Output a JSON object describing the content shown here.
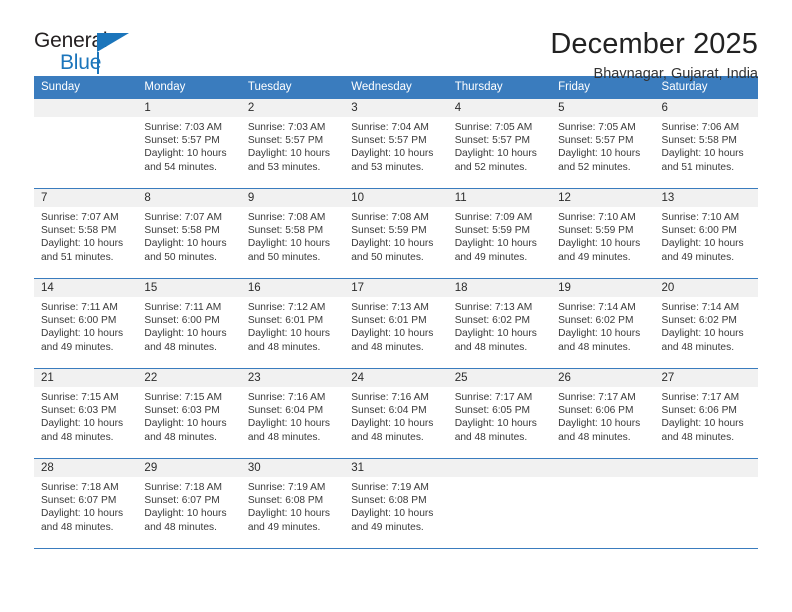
{
  "logo": {
    "line1": "General",
    "line2": "Blue",
    "brand_color": "#1b75bb",
    "triangle_icon": "triangle-icon"
  },
  "header": {
    "title": "December 2025",
    "subtitle": "Bhavnagar, Gujarat, India"
  },
  "calendar": {
    "accent_color": "#3a7cbe",
    "daynum_bg": "#f1f1f1",
    "weekdays": [
      "Sunday",
      "Monday",
      "Tuesday",
      "Wednesday",
      "Thursday",
      "Friday",
      "Saturday"
    ],
    "weeks": [
      [
        {
          "day": "",
          "sunrise": "",
          "sunset": "",
          "daylight1": "",
          "daylight2": ""
        },
        {
          "day": "1",
          "sunrise": "Sunrise: 7:03 AM",
          "sunset": "Sunset: 5:57 PM",
          "daylight1": "Daylight: 10 hours",
          "daylight2": "and 54 minutes."
        },
        {
          "day": "2",
          "sunrise": "Sunrise: 7:03 AM",
          "sunset": "Sunset: 5:57 PM",
          "daylight1": "Daylight: 10 hours",
          "daylight2": "and 53 minutes."
        },
        {
          "day": "3",
          "sunrise": "Sunrise: 7:04 AM",
          "sunset": "Sunset: 5:57 PM",
          "daylight1": "Daylight: 10 hours",
          "daylight2": "and 53 minutes."
        },
        {
          "day": "4",
          "sunrise": "Sunrise: 7:05 AM",
          "sunset": "Sunset: 5:57 PM",
          "daylight1": "Daylight: 10 hours",
          "daylight2": "and 52 minutes."
        },
        {
          "day": "5",
          "sunrise": "Sunrise: 7:05 AM",
          "sunset": "Sunset: 5:57 PM",
          "daylight1": "Daylight: 10 hours",
          "daylight2": "and 52 minutes."
        },
        {
          "day": "6",
          "sunrise": "Sunrise: 7:06 AM",
          "sunset": "Sunset: 5:58 PM",
          "daylight1": "Daylight: 10 hours",
          "daylight2": "and 51 minutes."
        }
      ],
      [
        {
          "day": "7",
          "sunrise": "Sunrise: 7:07 AM",
          "sunset": "Sunset: 5:58 PM",
          "daylight1": "Daylight: 10 hours",
          "daylight2": "and 51 minutes."
        },
        {
          "day": "8",
          "sunrise": "Sunrise: 7:07 AM",
          "sunset": "Sunset: 5:58 PM",
          "daylight1": "Daylight: 10 hours",
          "daylight2": "and 50 minutes."
        },
        {
          "day": "9",
          "sunrise": "Sunrise: 7:08 AM",
          "sunset": "Sunset: 5:58 PM",
          "daylight1": "Daylight: 10 hours",
          "daylight2": "and 50 minutes."
        },
        {
          "day": "10",
          "sunrise": "Sunrise: 7:08 AM",
          "sunset": "Sunset: 5:59 PM",
          "daylight1": "Daylight: 10 hours",
          "daylight2": "and 50 minutes."
        },
        {
          "day": "11",
          "sunrise": "Sunrise: 7:09 AM",
          "sunset": "Sunset: 5:59 PM",
          "daylight1": "Daylight: 10 hours",
          "daylight2": "and 49 minutes."
        },
        {
          "day": "12",
          "sunrise": "Sunrise: 7:10 AM",
          "sunset": "Sunset: 5:59 PM",
          "daylight1": "Daylight: 10 hours",
          "daylight2": "and 49 minutes."
        },
        {
          "day": "13",
          "sunrise": "Sunrise: 7:10 AM",
          "sunset": "Sunset: 6:00 PM",
          "daylight1": "Daylight: 10 hours",
          "daylight2": "and 49 minutes."
        }
      ],
      [
        {
          "day": "14",
          "sunrise": "Sunrise: 7:11 AM",
          "sunset": "Sunset: 6:00 PM",
          "daylight1": "Daylight: 10 hours",
          "daylight2": "and 49 minutes."
        },
        {
          "day": "15",
          "sunrise": "Sunrise: 7:11 AM",
          "sunset": "Sunset: 6:00 PM",
          "daylight1": "Daylight: 10 hours",
          "daylight2": "and 48 minutes."
        },
        {
          "day": "16",
          "sunrise": "Sunrise: 7:12 AM",
          "sunset": "Sunset: 6:01 PM",
          "daylight1": "Daylight: 10 hours",
          "daylight2": "and 48 minutes."
        },
        {
          "day": "17",
          "sunrise": "Sunrise: 7:13 AM",
          "sunset": "Sunset: 6:01 PM",
          "daylight1": "Daylight: 10 hours",
          "daylight2": "and 48 minutes."
        },
        {
          "day": "18",
          "sunrise": "Sunrise: 7:13 AM",
          "sunset": "Sunset: 6:02 PM",
          "daylight1": "Daylight: 10 hours",
          "daylight2": "and 48 minutes."
        },
        {
          "day": "19",
          "sunrise": "Sunrise: 7:14 AM",
          "sunset": "Sunset: 6:02 PM",
          "daylight1": "Daylight: 10 hours",
          "daylight2": "and 48 minutes."
        },
        {
          "day": "20",
          "sunrise": "Sunrise: 7:14 AM",
          "sunset": "Sunset: 6:02 PM",
          "daylight1": "Daylight: 10 hours",
          "daylight2": "and 48 minutes."
        }
      ],
      [
        {
          "day": "21",
          "sunrise": "Sunrise: 7:15 AM",
          "sunset": "Sunset: 6:03 PM",
          "daylight1": "Daylight: 10 hours",
          "daylight2": "and 48 minutes."
        },
        {
          "day": "22",
          "sunrise": "Sunrise: 7:15 AM",
          "sunset": "Sunset: 6:03 PM",
          "daylight1": "Daylight: 10 hours",
          "daylight2": "and 48 minutes."
        },
        {
          "day": "23",
          "sunrise": "Sunrise: 7:16 AM",
          "sunset": "Sunset: 6:04 PM",
          "daylight1": "Daylight: 10 hours",
          "daylight2": "and 48 minutes."
        },
        {
          "day": "24",
          "sunrise": "Sunrise: 7:16 AM",
          "sunset": "Sunset: 6:04 PM",
          "daylight1": "Daylight: 10 hours",
          "daylight2": "and 48 minutes."
        },
        {
          "day": "25",
          "sunrise": "Sunrise: 7:17 AM",
          "sunset": "Sunset: 6:05 PM",
          "daylight1": "Daylight: 10 hours",
          "daylight2": "and 48 minutes."
        },
        {
          "day": "26",
          "sunrise": "Sunrise: 7:17 AM",
          "sunset": "Sunset: 6:06 PM",
          "daylight1": "Daylight: 10 hours",
          "daylight2": "and 48 minutes."
        },
        {
          "day": "27",
          "sunrise": "Sunrise: 7:17 AM",
          "sunset": "Sunset: 6:06 PM",
          "daylight1": "Daylight: 10 hours",
          "daylight2": "and 48 minutes."
        }
      ],
      [
        {
          "day": "28",
          "sunrise": "Sunrise: 7:18 AM",
          "sunset": "Sunset: 6:07 PM",
          "daylight1": "Daylight: 10 hours",
          "daylight2": "and 48 minutes."
        },
        {
          "day": "29",
          "sunrise": "Sunrise: 7:18 AM",
          "sunset": "Sunset: 6:07 PM",
          "daylight1": "Daylight: 10 hours",
          "daylight2": "and 48 minutes."
        },
        {
          "day": "30",
          "sunrise": "Sunrise: 7:19 AM",
          "sunset": "Sunset: 6:08 PM",
          "daylight1": "Daylight: 10 hours",
          "daylight2": "and 49 minutes."
        },
        {
          "day": "31",
          "sunrise": "Sunrise: 7:19 AM",
          "sunset": "Sunset: 6:08 PM",
          "daylight1": "Daylight: 10 hours",
          "daylight2": "and 49 minutes."
        },
        {
          "day": "",
          "sunrise": "",
          "sunset": "",
          "daylight1": "",
          "daylight2": ""
        },
        {
          "day": "",
          "sunrise": "",
          "sunset": "",
          "daylight1": "",
          "daylight2": ""
        },
        {
          "day": "",
          "sunrise": "",
          "sunset": "",
          "daylight1": "",
          "daylight2": ""
        }
      ]
    ]
  }
}
